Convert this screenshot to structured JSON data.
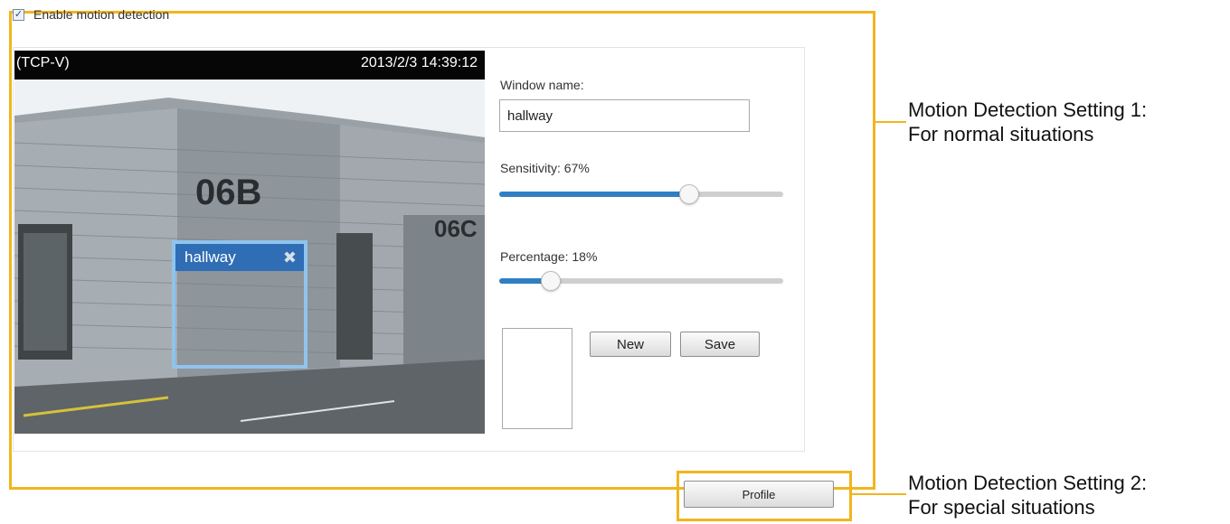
{
  "enable": {
    "label": "Enable motion detection",
    "checked": true
  },
  "video": {
    "stream_label": "(TCP-V)",
    "timestamp": "2013/2/3 14:39:12",
    "scene_text": [
      "06B",
      "06C"
    ]
  },
  "window_overlay": {
    "name": "hallway",
    "close_glyph": "✖"
  },
  "form": {
    "window_name_label": "Window name:",
    "window_name_value": "hallway",
    "sensitivity_label": "Sensitivity: 67%",
    "sensitivity_value": 0.67,
    "percentage_label": "Percentage: 18%",
    "percentage_value": 0.18,
    "new_label": "New",
    "save_label": "Save"
  },
  "profile_button": {
    "label": "Profile"
  },
  "annotations": {
    "setting1": [
      "Motion Detection Setting 1:",
      "For normal situations"
    ],
    "setting2": [
      "Motion Detection Setting 2:",
      "For special situations"
    ]
  },
  "colors": {
    "highlight": "#f2b51c",
    "slider_fill": "#2f7fc4",
    "window_label_bg": "#2f6db4",
    "window_border": "#8fc4ee"
  }
}
